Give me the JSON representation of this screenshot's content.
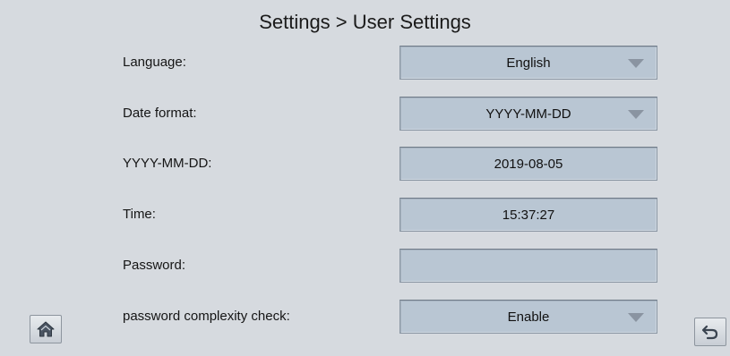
{
  "header": {
    "title": "Settings > User Settings"
  },
  "fields": [
    {
      "label": "Language:",
      "value": "English",
      "type": "dropdown"
    },
    {
      "label": "Date format:",
      "value": "YYYY-MM-DD",
      "type": "dropdown"
    },
    {
      "label": "YYYY-MM-DD:",
      "value": "2019-08-05",
      "type": "input"
    },
    {
      "label": "Time:",
      "value": "15:37:27",
      "type": "input"
    },
    {
      "label": "Password:",
      "value": "",
      "type": "password"
    },
    {
      "label": "password complexity check:",
      "value": "Enable",
      "type": "dropdown"
    }
  ],
  "footer": {
    "home_icon": "home-icon",
    "back_icon": "back-arrow-icon"
  },
  "colors": {
    "background": "#d6dadf",
    "field": "#b9c6d3",
    "caret": "#8a94a1"
  }
}
